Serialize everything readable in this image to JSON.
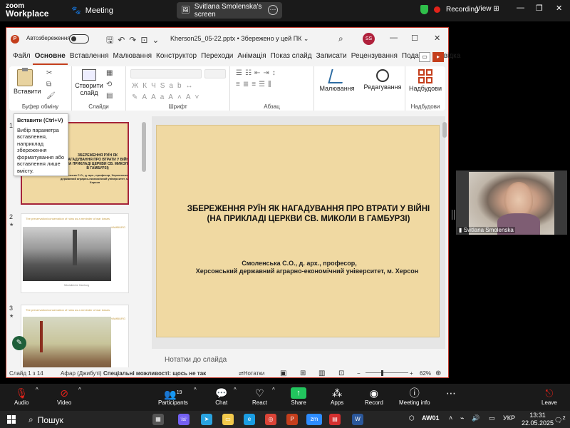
{
  "zoom": {
    "logo_line1": "zoom",
    "logo_line2": "Workplace",
    "meeting_label": "Meeting",
    "share_label": "Svitlana Smolenska's screen",
    "recording_label": "Recording",
    "view_label": "View",
    "toolbar": {
      "audio": "Audio",
      "video": "Video",
      "participants": "Participants",
      "participants_count": "19",
      "chat": "Chat",
      "react": "React",
      "share": "Share",
      "apps": "Apps",
      "record": "Record",
      "meeting_info": "Meeting info",
      "leave": "Leave"
    }
  },
  "ppt": {
    "autosave_label": "Автозбереження",
    "filename": "Kherson25_05-22.pptx • Збережено у цей ПК ⌄",
    "user_initials": "SS",
    "tabs": [
      "Файл",
      "Основне",
      "Вставлення",
      "Малювання",
      "Конструктор",
      "Переходи",
      "Анімація",
      "Показ слайд",
      "Записати",
      "Рецензування",
      "Подання",
      "Довідка"
    ],
    "active_tab": "Основне",
    "ribbon": {
      "paste_label": "Вставити",
      "create_slide_label": "Створити слайд",
      "drawing_label": "Малювання",
      "editing_label": "Редагування",
      "addins_label": "Надбудови",
      "group_clipboard": "Буфер обміну",
      "group_slides": "Слайди",
      "group_font": "Шрифт",
      "group_paragraph": "Абзац",
      "group_addins": "Надбудови"
    },
    "tooltip": {
      "title": "Вставити (Ctrl+V)",
      "body": "Вибір параметра вставлення, наприклад збереження форматування або вставлення лише вмісту."
    },
    "thumbnails": [
      {
        "number": "1",
        "title": "ЗБЕРЕЖЕННЯ РУЇН ЯК НАГАДУВАННЯ ПРО ВТРАТИ У ВІЙНІ (НА ПРИКЛАДІ ЦЕРКВИ СВ. МИКОЛИ В ГАМБУРЗІ)",
        "author": "Смоленська С.О., д. арх., професор, Херсонський державний аграрно-економічний університет, м. Херсон"
      },
      {
        "number": "2",
        "header": "The preservation/conservation of ruins as a reminder of war losses",
        "right_label": "HAMBURG",
        "caption": "Nikolaikirche Hamburg"
      },
      {
        "number": "3",
        "header": "The preservation/conservation of ruins as a reminder of war losses",
        "right_label": "HAMBURG"
      }
    ],
    "slide": {
      "title_line1": "ЗБЕРЕЖЕННЯ РУЇН ЯК НАГАДУВАННЯ ПРО ВТРАТИ У ВІЙНІ",
      "title_line2": "(НА ПРИКЛАДІ ЦЕРКВИ СВ. МИКОЛИ В ГАМБУРЗІ)",
      "author_line1": "Смоленська С.О., д. арх., професор,",
      "author_line2": "Херсонський державний аграрно-економічний університет, м. Херсон"
    },
    "notes_placeholder": "Нотатки до слайда",
    "status": {
      "slide_of": "Слайд 1 з 14",
      "language": "Афар (Джибуті)",
      "accessibility": "Спеціальні можливості: щось не так",
      "notes": "Нотатки",
      "zoom_level": "62%"
    }
  },
  "webcam": {
    "name": "Svitlana Smolenska"
  },
  "taskbar": {
    "search_label": "Пошук",
    "aw_label": "AW01",
    "lang": "УКР",
    "time": "13:31",
    "date": "22.05.2025",
    "notifications": "2"
  },
  "colors": {
    "slide_bg": "#f0d9a2",
    "accent_ppt": "#c43e1c",
    "selected_thumb": "#a5243a",
    "zoom_share": "#22c55e",
    "recording_dot": "#e2231a"
  }
}
